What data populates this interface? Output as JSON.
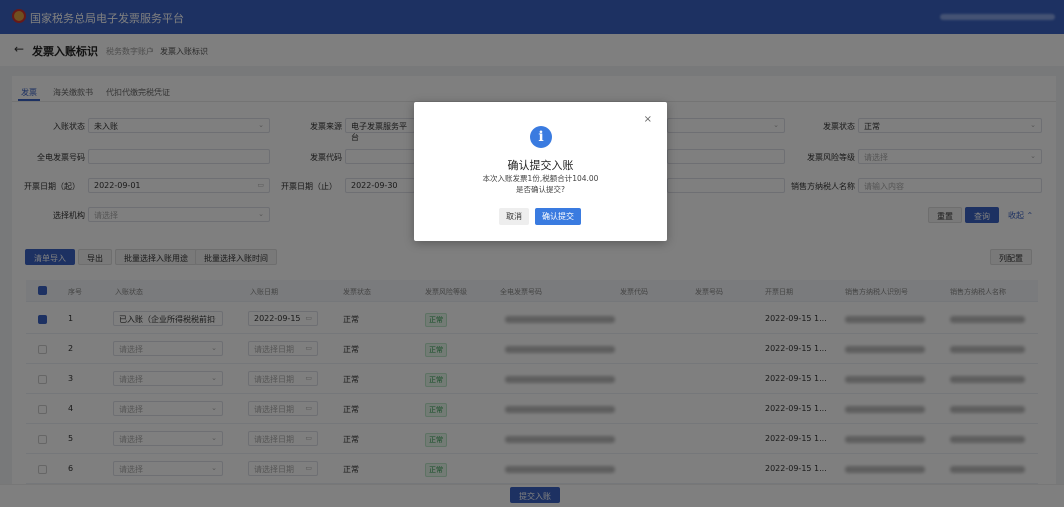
{
  "app": {
    "title": "国家税务总局电子发票服务平台"
  },
  "page": {
    "title": "发票入账标识",
    "breadcrumb": [
      "税务数字账户",
      "发票入账标识"
    ]
  },
  "tabs": [
    {
      "label": "发票",
      "active": true
    },
    {
      "label": "海关缴款书"
    },
    {
      "label": "代扣代缴完税凭证"
    }
  ],
  "filters": {
    "entry_status": {
      "label": "入账状态",
      "value": "未入账"
    },
    "invoice_source": {
      "label": "发票来源",
      "value": "电子发票服务平台"
    },
    "invoice_status": {
      "label": "发票状态",
      "value": "正常"
    },
    "einvoice_no": {
      "label": "全电发票号码",
      "value": ""
    },
    "invoice_code": {
      "label": "发票代码",
      "value": ""
    },
    "risk_level": {
      "label": "发票风险等级",
      "placeholder": "请选择"
    },
    "date_from": {
      "label": "开票日期（起）",
      "value": "2022-09-01"
    },
    "date_to": {
      "label": "开票日期（止）",
      "value": "2022-09-30"
    },
    "seller_name": {
      "label": "销售方纳税人名称",
      "placeholder": "请输入内容"
    },
    "org": {
      "label": "选择机构",
      "placeholder": "请选择"
    },
    "reset": "重置",
    "search": "查询",
    "collapse": "收起"
  },
  "toolbar": {
    "import": "清单导入",
    "export": "导出",
    "batch_use": "批量选择入账用途",
    "batch_time": "批量选择入账时间",
    "columns": "列配置"
  },
  "table": {
    "headers": [
      "序号",
      "入账状态",
      "入账日期",
      "发票状态",
      "发票风险等级",
      "全电发票号码",
      "发票代码",
      "发票号码",
      "开票日期",
      "销售方纳税人识别号",
      "销售方纳税人名称"
    ],
    "rows": [
      {
        "no": "1",
        "checked": true,
        "entry": "已入账（企业所得税税前扣",
        "date": "2022-09-15",
        "status": "正常",
        "risk": "正常",
        "issue_date": "2022-09-15 1..."
      },
      {
        "no": "2",
        "checked": false,
        "entry": "请选择",
        "date": "请选择日期",
        "status": "正常",
        "risk": "正常",
        "issue_date": "2022-09-15 1..."
      },
      {
        "no": "3",
        "checked": false,
        "entry": "请选择",
        "date": "请选择日期",
        "status": "正常",
        "risk": "正常",
        "issue_date": "2022-09-15 1..."
      },
      {
        "no": "4",
        "checked": false,
        "entry": "请选择",
        "date": "请选择日期",
        "status": "正常",
        "risk": "正常",
        "issue_date": "2022-09-15 1..."
      },
      {
        "no": "5",
        "checked": false,
        "entry": "请选择",
        "date": "请选择日期",
        "status": "正常",
        "risk": "正常",
        "issue_date": "2022-09-15 1..."
      },
      {
        "no": "6",
        "checked": false,
        "entry": "请选择",
        "date": "请选择日期",
        "status": "正常",
        "risk": "正常",
        "issue_date": "2022-09-15 1..."
      }
    ]
  },
  "submit": "提交入账",
  "modal": {
    "icon": "info-icon",
    "title": "确认提交入账",
    "line1": "本次入账发票1份,税额合计104.00",
    "line2": "是否确认提交?",
    "cancel": "取消",
    "confirm": "确认提交"
  },
  "colors": {
    "brand": "#3a62c4",
    "info": "#3a7be0",
    "success": "#2c9a4c"
  }
}
